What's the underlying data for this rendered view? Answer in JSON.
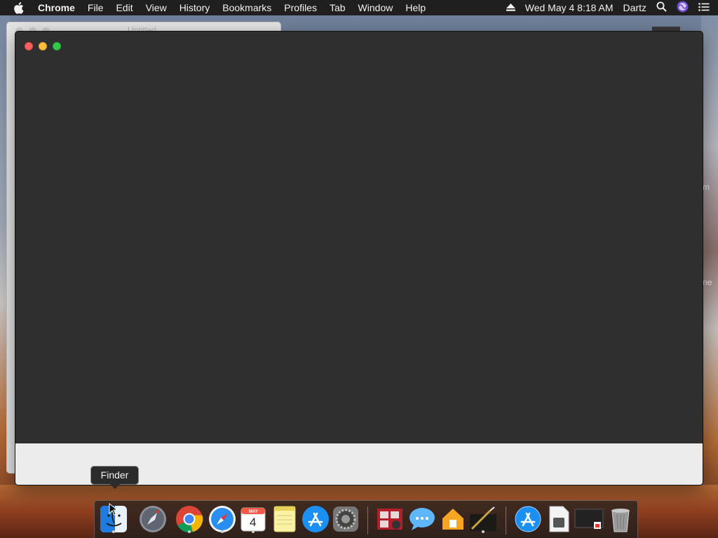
{
  "menubar": {
    "app_name": "Chrome",
    "items": [
      "File",
      "Edit",
      "View",
      "History",
      "Bookmarks",
      "Profiles",
      "Tab",
      "Window",
      "Help"
    ],
    "clock": "Wed May 4  8:18 AM",
    "user": "Dartz"
  },
  "background_window": {
    "title": "Untitled"
  },
  "wallpaper_fragments": [
    "m",
    "ne"
  ],
  "tooltip": {
    "text": "Finder"
  },
  "dock": {
    "apps": [
      {
        "name": "Finder",
        "icon": "finder-icon",
        "running": true
      },
      {
        "name": "Launchpad",
        "icon": "launchpad-icon",
        "running": false
      },
      {
        "name": "Google Chrome",
        "icon": "chrome-icon",
        "running": true
      },
      {
        "name": "Safari",
        "icon": "safari-icon",
        "running": true
      },
      {
        "name": "Calendar",
        "icon": "calendar-icon",
        "running": true,
        "month": "MAY",
        "day": "4"
      },
      {
        "name": "Notes",
        "icon": "notes-icon",
        "running": false
      },
      {
        "name": "App Store",
        "icon": "app-store-icon",
        "running": false
      },
      {
        "name": "System Preferences",
        "icon": "system-preferences-icon",
        "running": false
      },
      {
        "name": "Photo Booth",
        "icon": "photo-booth-icon",
        "running": false
      },
      {
        "name": "Messages",
        "icon": "messages-icon",
        "running": false
      },
      {
        "name": "Home",
        "icon": "home-icon",
        "running": false
      },
      {
        "name": "Terminal Utility",
        "icon": "magic-wand-icon",
        "running": true
      },
      {
        "name": "App Store Download",
        "icon": "app-store-icon",
        "running": false
      },
      {
        "name": "Document",
        "icon": "document-icon",
        "running": false
      },
      {
        "name": "Screenshot",
        "icon": "screenshot-icon",
        "running": false
      },
      {
        "name": "Trash",
        "icon": "trash-icon",
        "running": false
      }
    ]
  },
  "colors": {
    "menubar_bg": "#1f1f1f",
    "window_dark": "#2f2f2f",
    "window_light": "#ececec",
    "close": "#fc605c",
    "minimize": "#fdbc40",
    "maximize": "#34c84a"
  }
}
